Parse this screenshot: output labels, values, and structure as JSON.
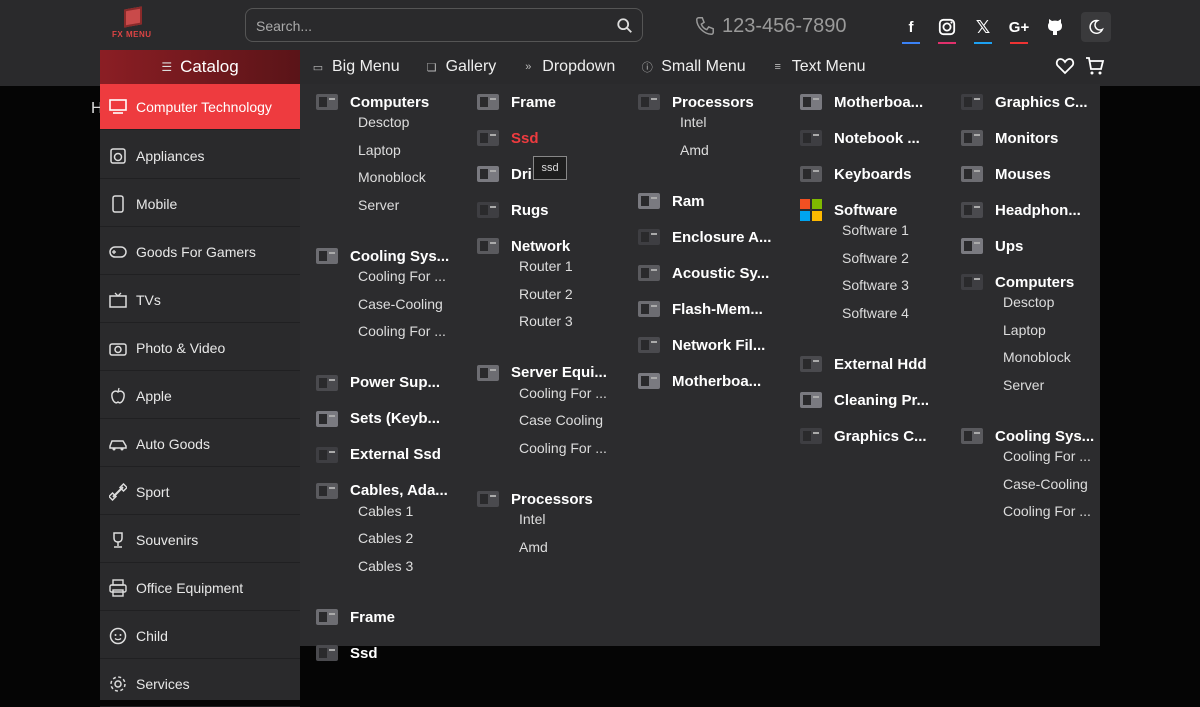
{
  "brand": {
    "logo_text": "FX MENU"
  },
  "search": {
    "placeholder": "Search..."
  },
  "contact": {
    "phone": "123-456-7890"
  },
  "social": [
    {
      "name": "facebook",
      "glyph": "f",
      "color": "#3b82f6"
    },
    {
      "name": "instagram",
      "glyph": "◎",
      "color": "#e1306c"
    },
    {
      "name": "x",
      "glyph": "𝕏",
      "color": "#1da1f2"
    },
    {
      "name": "google-plus",
      "glyph": "G+",
      "color": "#e33"
    },
    {
      "name": "github",
      "glyph": "",
      "color": "#2a2a2c"
    }
  ],
  "catalog_label": "Catalog",
  "nav": [
    {
      "label": "Big Menu",
      "icon": "window-icon"
    },
    {
      "label": "Gallery",
      "icon": "images-icon"
    },
    {
      "label": "Dropdown",
      "icon": "chevron-down-icon"
    },
    {
      "label": "Small Menu",
      "icon": "info-icon"
    },
    {
      "label": "Text Menu",
      "icon": "lines-icon"
    }
  ],
  "breadcrumb_char": "H",
  "sidebar": [
    "Computer Technology",
    "Appliances",
    "Mobile",
    "Goods For Gamers",
    "TVs",
    "Photo & Video",
    "Apple",
    "Auto Goods",
    "Sport",
    "Souvenirs",
    "Office Equipment",
    "Child",
    "Services"
  ],
  "tooltip": "ssd",
  "mega": {
    "col1": [
      {
        "title": "Computers",
        "subs": [
          "Desctop",
          "Laptop",
          "Monoblock",
          "Server"
        ]
      },
      {
        "title": "Cooling Sys...",
        "subs": [
          "Cooling For ...",
          "Case-Cooling",
          "Cooling For ..."
        ]
      },
      {
        "title": "Power Sup...",
        "subs": []
      },
      {
        "title": "Sets (Keyb...",
        "subs": []
      },
      {
        "title": "External Ssd",
        "subs": []
      },
      {
        "title": "Cables, Ada...",
        "subs": [
          "Cables 1",
          "Cables 2",
          "Cables 3"
        ]
      },
      {
        "title": "Frame",
        "subs": []
      },
      {
        "title": "Ssd",
        "subs": []
      }
    ],
    "col2": [
      {
        "title": "Frame",
        "subs": []
      },
      {
        "title": "Ssd",
        "subs": []
      },
      {
        "title": "Dri",
        "subs": []
      },
      {
        "title": "Rugs",
        "subs": []
      },
      {
        "title": "Network",
        "subs": [
          "Router 1",
          "Router 2",
          "Router 3"
        ]
      },
      {
        "title": "Server Equi...",
        "subs": [
          "Cooling For ...",
          "Case Cooling",
          "Cooling For ..."
        ]
      },
      {
        "title": "Processors",
        "subs": [
          "Intel",
          "Amd"
        ]
      }
    ],
    "col3": [
      {
        "title": "Processors",
        "subs": [
          "Intel",
          "Amd"
        ]
      },
      {
        "title": "Ram",
        "subs": []
      },
      {
        "title": "Enclosure A...",
        "subs": []
      },
      {
        "title": "Acoustic Sy...",
        "subs": []
      },
      {
        "title": "Flash-Mem...",
        "subs": []
      },
      {
        "title": "Network Fil...",
        "subs": []
      },
      {
        "title": "Motherboa...",
        "subs": []
      }
    ],
    "col4": [
      {
        "title": "Motherboa...",
        "subs": []
      },
      {
        "title": "Notebook ...",
        "subs": []
      },
      {
        "title": "Keyboards",
        "subs": []
      },
      {
        "title": "Software",
        "subs": [
          "Software 1",
          "Software 2",
          "Software 3",
          "Software 4"
        ]
      },
      {
        "title": "External Hdd",
        "subs": []
      },
      {
        "title": "Cleaning Pr...",
        "subs": []
      },
      {
        "title": "Graphics C...",
        "subs": []
      }
    ],
    "col5": [
      {
        "title": "Graphics C...",
        "subs": []
      },
      {
        "title": "Monitors",
        "subs": []
      },
      {
        "title": "Mouses",
        "subs": []
      },
      {
        "title": "Headphon...",
        "subs": []
      },
      {
        "title": "Ups",
        "subs": []
      },
      {
        "title": "Computers",
        "subs": [
          "Desctop",
          "Laptop",
          "Monoblock",
          "Server"
        ]
      },
      {
        "title": "Cooling Sys...",
        "subs": [
          "Cooling For ...",
          "Case-Cooling",
          "Cooling For ..."
        ]
      }
    ]
  },
  "colors": {
    "accent": "#ee3b3f",
    "panel": "#2c2c2e",
    "header": "#2a2a2c"
  }
}
